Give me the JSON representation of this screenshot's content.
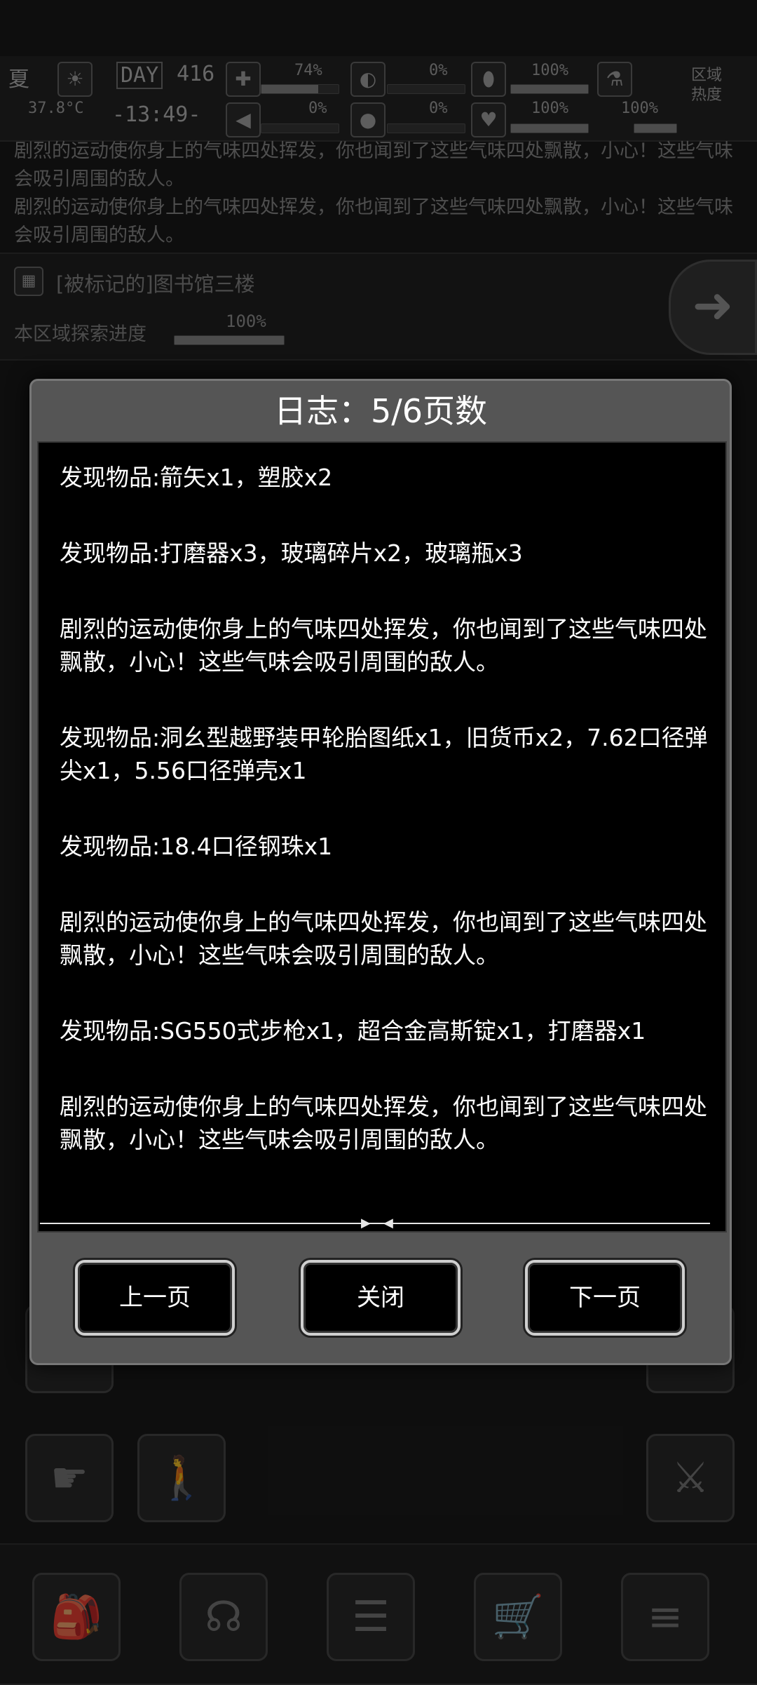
{
  "status": {
    "season": "夏",
    "temperature": "37.8°C",
    "day_label": "DAY",
    "day": "416",
    "time": "-13:49-",
    "stat_values": [
      "74%",
      "0%",
      "100%",
      "0%",
      "0%",
      "100%",
      "100%"
    ],
    "stat_fills": [
      0.74,
      0,
      1.0,
      0,
      0,
      1.0,
      1.0
    ],
    "heat_label": "区域热度"
  },
  "background_messages": [
    "剧烈的运动使你身上的气味四处挥发，你也闻到了这些气味四处飘散，小心！这些气味会吸引周围的敌人。",
    "剧烈的运动使你身上的气味四处挥发，你也闻到了这些气味四处飘散，小心！这些气味会吸引周围的敌人。"
  ],
  "location": {
    "name": "[被标记的]图书馆三楼",
    "progress_label": "本区域探索进度",
    "progress_value": "100%",
    "progress_fill": 1.0
  },
  "dialog": {
    "title": "日志：5/6页数",
    "entries": [
      "发现物品:箭矢x1，塑胶x2",
      "发现物品:打磨器x3，玻璃碎片x2，玻璃瓶x3",
      "剧烈的运动使你身上的气味四处挥发，你也闻到了这些气味四处飘散，小心！这些气味会吸引周围的敌人。",
      "发现物品:洞幺型越野装甲轮胎图纸x1，旧货币x2，7.62口径弹尖x1，5.56口径弹壳x1",
      "发现物品:18.4口径钢珠x1",
      "剧烈的运动使你身上的气味四处挥发，你也闻到了这些气味四处飘散，小心！这些气味会吸引周围的敌人。",
      "发现物品:SG550式步枪x1，超合金高斯锭x1，打磨器x1",
      "剧烈的运动使你身上的气味四处挥发，你也闻到了这些气味四处飘散，小心！这些气味会吸引周围的敌人。"
    ],
    "prev_label": "上一页",
    "close_label": "关闭",
    "next_label": "下一页"
  },
  "colors": {
    "dialog_bg": "#555555",
    "content_bg": "#000000",
    "text": "#ffffff"
  }
}
